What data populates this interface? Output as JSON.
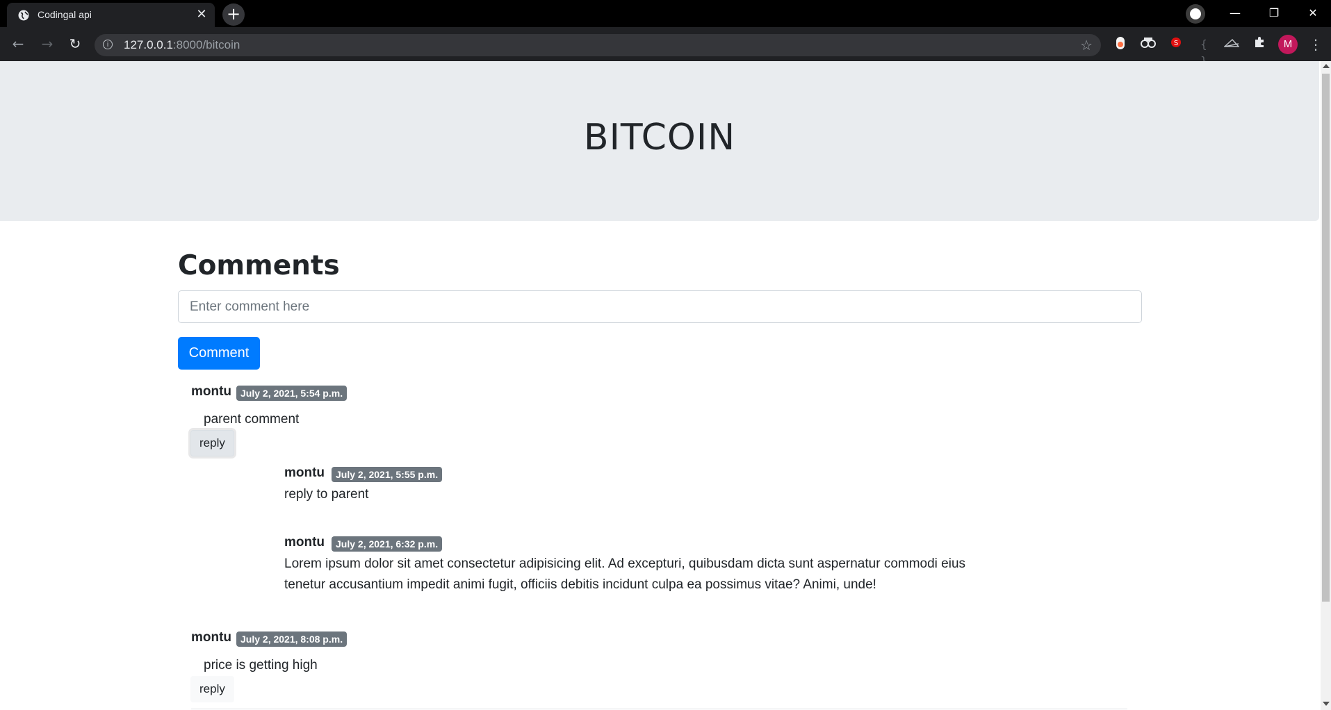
{
  "browser": {
    "tab_title": "Codingal api",
    "tab_close": "✕",
    "new_tab": "+",
    "url_host": "127.0.0.1",
    "url_rest": ":8000/bitcoin",
    "profile_initial": "M",
    "window_controls": {
      "minimize": "—",
      "restore": "❐",
      "close": "✕"
    }
  },
  "page": {
    "title": "BITCOIN",
    "comments_heading": "Comments",
    "comment_placeholder": "Enter comment here",
    "comment_button": "Comment"
  },
  "comments": [
    {
      "author": "montu",
      "date": "July 2, 2021, 5:54 p.m.",
      "text": "parent comment",
      "reply_label": "reply",
      "replies": [
        {
          "author": "montu",
          "date": "July 2, 2021, 5:55 p.m.",
          "text": "reply to parent"
        },
        {
          "author": "montu",
          "date": "July 2, 2021, 6:32 p.m.",
          "text_line1": "Lorem ipsum dolor sit amet consectetur adipisicing elit. Ad excepturi, quibusdam dicta sunt aspernatur commodi eius",
          "text_line2": "tenetur accusantium impedit animi fugit, officiis debitis incidunt culpa ea possimus vitae? Animi, unde!"
        }
      ]
    },
    {
      "author": "montu",
      "date": "July 2, 2021, 8:08 p.m.",
      "text": "price is getting high",
      "reply_label": "reply"
    }
  ]
}
